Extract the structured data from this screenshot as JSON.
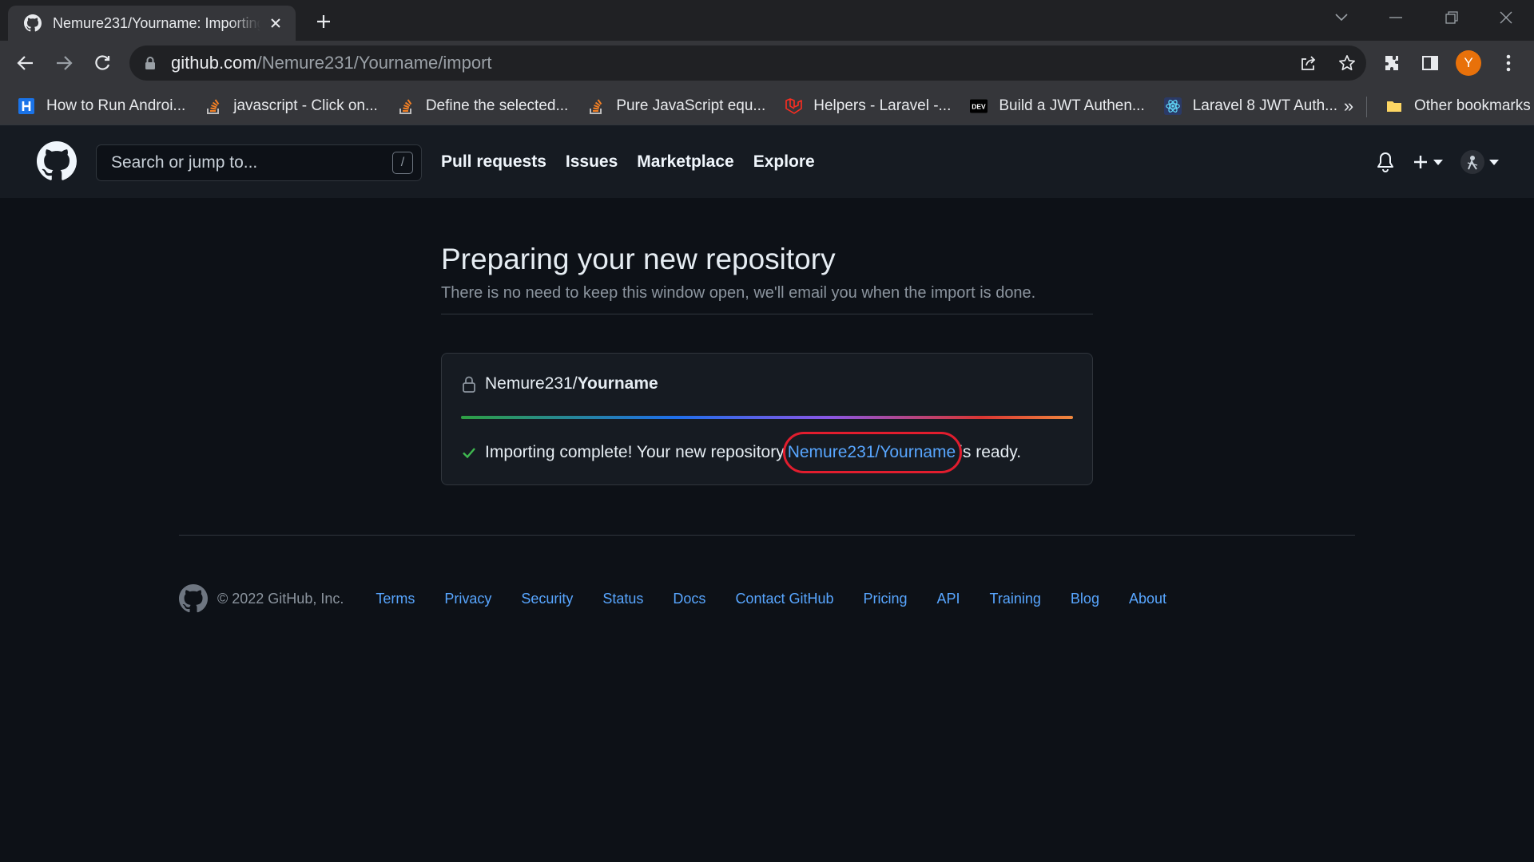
{
  "browser": {
    "tab_title": "Nemure231/Yourname: Importing",
    "url_host": "github.com",
    "url_path": "/Nemure231/Yourname/import",
    "profile_initial": "Y",
    "bookmarks": [
      {
        "label": "How to Run Androi...",
        "icon": "H"
      },
      {
        "label": "javascript - Click on...",
        "icon": "stackoverflow"
      },
      {
        "label": "Define the selected...",
        "icon": "stackoverflow"
      },
      {
        "label": "Pure JavaScript equ...",
        "icon": "stackoverflow"
      },
      {
        "label": "Helpers - Laravel -...",
        "icon": "laravel"
      },
      {
        "label": "Build a JWT Authen...",
        "icon": "DEV"
      },
      {
        "label": "Laravel 8 JWT Auth...",
        "icon": "react"
      }
    ],
    "more_bookmarks": "»",
    "other_bookmarks": "Other bookmarks"
  },
  "github": {
    "search_placeholder": "Search or jump to...",
    "search_key": "/",
    "nav": [
      "Pull requests",
      "Issues",
      "Marketplace",
      "Explore"
    ]
  },
  "main": {
    "title": "Preparing your new repository",
    "subtitle": "There is no need to keep this window open, we'll email you when the import is done.",
    "repo_owner": "Nemure231/",
    "repo_name": "Yourname",
    "progress_fraction": 1.0,
    "status_prefix": "Importing complete! Your new repository",
    "status_link": "Nemure231/Yourname",
    "status_suffix": "is ready."
  },
  "footer": {
    "copyright": "© 2022 GitHub, Inc.",
    "links": [
      "Terms",
      "Privacy",
      "Security",
      "Status",
      "Docs",
      "Contact GitHub",
      "Pricing",
      "API",
      "Training",
      "Blog",
      "About"
    ]
  },
  "colors": {
    "link": "#58a6ff",
    "annotation": "#e11d2e",
    "success": "#3fb950"
  }
}
